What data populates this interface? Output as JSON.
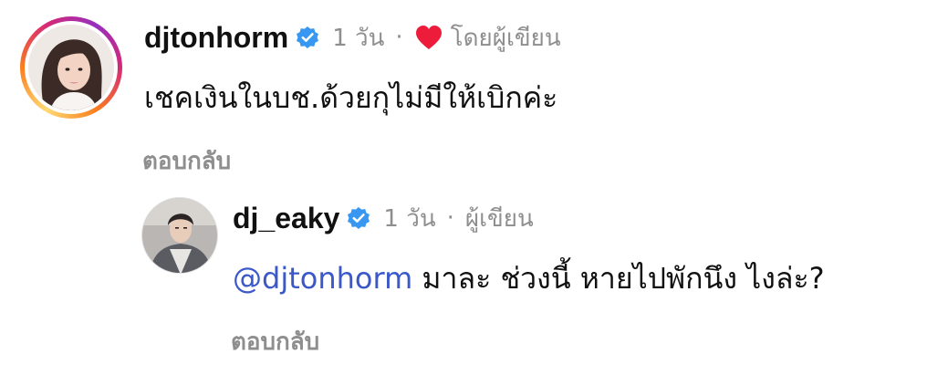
{
  "comments": [
    {
      "username": "djtonhorm",
      "verified": true,
      "time": "1 วัน",
      "separator": "·",
      "liked_by_author": true,
      "liked_by_author_label": "โดยผู้เขียน",
      "text": "เชคเงินในบช.ด้วยกุไม่มีให้เบิกค่ะ",
      "reply_label": "ตอบกลับ",
      "avatar_style": "story-ring"
    },
    {
      "username": "dj_eaky",
      "verified": true,
      "time": "1 วัน",
      "separator": "·",
      "author_label": "ผู้เขียน",
      "mention": "@djtonhorm",
      "text": "มาละ ช่วงนี้ หายไปพักนึง ไงล่ะ?",
      "reply_label": "ตอบกลับ",
      "avatar_style": "plain"
    }
  ],
  "colors": {
    "text": "#111111",
    "secondary_text": "#8e8e8e",
    "verified_badge": "#3897f0",
    "heart": "#ed1c3a",
    "mention": "#3a58c9"
  },
  "icons": {
    "verified": "verified-badge-icon",
    "heart": "heart-icon"
  }
}
